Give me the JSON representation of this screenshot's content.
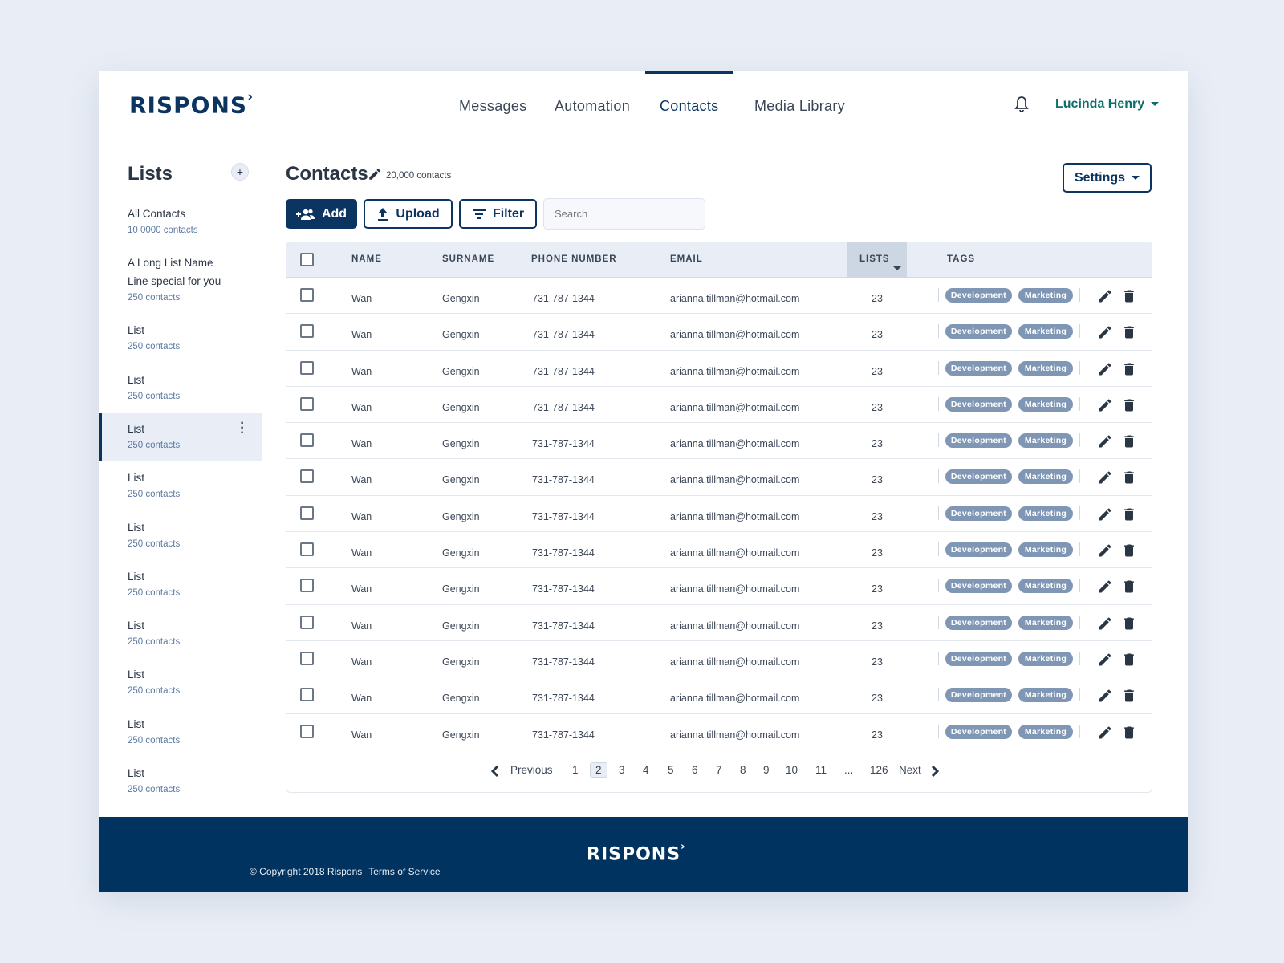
{
  "brand": "RISPONS",
  "nav": {
    "items": [
      {
        "label": "Messages"
      },
      {
        "label": "Automation"
      },
      {
        "label": "Contacts",
        "active": true
      },
      {
        "label": "Media Library"
      }
    ]
  },
  "user": {
    "name": "Lucinda Henry"
  },
  "sidebar": {
    "title": "Lists",
    "items": [
      {
        "name": "All Contacts",
        "count": "10 0000 contacts"
      },
      {
        "name": "A Long List Name Line special for you",
        "count": "250 contacts"
      },
      {
        "name": "List",
        "count": "250 contacts"
      },
      {
        "name": "List",
        "count": "250 contacts"
      },
      {
        "name": "List",
        "count": "250 contacts",
        "active": true
      },
      {
        "name": "List",
        "count": "250 contacts"
      },
      {
        "name": "List",
        "count": "250 contacts"
      },
      {
        "name": "List",
        "count": "250 contacts"
      },
      {
        "name": "List",
        "count": "250 contacts"
      },
      {
        "name": "List",
        "count": "250 contacts"
      },
      {
        "name": "List",
        "count": "250 contacts"
      },
      {
        "name": "List",
        "count": "250 contacts"
      }
    ]
  },
  "main": {
    "title": "Contacts",
    "count": "20,000 contacts",
    "add_label": "Add",
    "upload_label": "Upload",
    "filter_label": "Filter",
    "search_placeholder": "Search",
    "settings_label": "Settings"
  },
  "table": {
    "columns": [
      "NAME",
      "SURNAME",
      "PHONE NUMBER",
      "EMAIL",
      "LISTS",
      "TAGS"
    ],
    "rows": [
      {
        "name": "Wan",
        "surname": "Gengxin",
        "phone": "731-787-1344",
        "email": "arianna.tillman@hotmail.com",
        "lists": "23",
        "tags": [
          "Development",
          "Marketing"
        ]
      },
      {
        "name": "Wan",
        "surname": "Gengxin",
        "phone": "731-787-1344",
        "email": "arianna.tillman@hotmail.com",
        "lists": "23",
        "tags": [
          "Development",
          "Marketing"
        ]
      },
      {
        "name": "Wan",
        "surname": "Gengxin",
        "phone": "731-787-1344",
        "email": "arianna.tillman@hotmail.com",
        "lists": "23",
        "tags": [
          "Development",
          "Marketing"
        ]
      },
      {
        "name": "Wan",
        "surname": "Gengxin",
        "phone": "731-787-1344",
        "email": "arianna.tillman@hotmail.com",
        "lists": "23",
        "tags": [
          "Development",
          "Marketing"
        ]
      },
      {
        "name": "Wan",
        "surname": "Gengxin",
        "phone": "731-787-1344",
        "email": "arianna.tillman@hotmail.com",
        "lists": "23",
        "tags": [
          "Development",
          "Marketing"
        ]
      },
      {
        "name": "Wan",
        "surname": "Gengxin",
        "phone": "731-787-1344",
        "email": "arianna.tillman@hotmail.com",
        "lists": "23",
        "tags": [
          "Development",
          "Marketing"
        ]
      },
      {
        "name": "Wan",
        "surname": "Gengxin",
        "phone": "731-787-1344",
        "email": "arianna.tillman@hotmail.com",
        "lists": "23",
        "tags": [
          "Development",
          "Marketing"
        ]
      },
      {
        "name": "Wan",
        "surname": "Gengxin",
        "phone": "731-787-1344",
        "email": "arianna.tillman@hotmail.com",
        "lists": "23",
        "tags": [
          "Development",
          "Marketing"
        ]
      },
      {
        "name": "Wan",
        "surname": "Gengxin",
        "phone": "731-787-1344",
        "email": "arianna.tillman@hotmail.com",
        "lists": "23",
        "tags": [
          "Development",
          "Marketing"
        ]
      },
      {
        "name": "Wan",
        "surname": "Gengxin",
        "phone": "731-787-1344",
        "email": "arianna.tillman@hotmail.com",
        "lists": "23",
        "tags": [
          "Development",
          "Marketing"
        ]
      },
      {
        "name": "Wan",
        "surname": "Gengxin",
        "phone": "731-787-1344",
        "email": "arianna.tillman@hotmail.com",
        "lists": "23",
        "tags": [
          "Development",
          "Marketing"
        ]
      },
      {
        "name": "Wan",
        "surname": "Gengxin",
        "phone": "731-787-1344",
        "email": "arianna.tillman@hotmail.com",
        "lists": "23",
        "tags": [
          "Development",
          "Marketing"
        ]
      },
      {
        "name": "Wan",
        "surname": "Gengxin",
        "phone": "731-787-1344",
        "email": "arianna.tillman@hotmail.com",
        "lists": "23",
        "tags": [
          "Development",
          "Marketing"
        ]
      }
    ]
  },
  "pagination": {
    "previous": "Previous",
    "next": "Next",
    "pages": [
      "1",
      "2",
      "3",
      "4",
      "5",
      "6",
      "7",
      "8",
      "9",
      "10",
      "11",
      "...",
      "126"
    ],
    "current": "2"
  },
  "footer": {
    "copyright": "© Copyright 2018 Rispons",
    "terms": "Terms of Service"
  }
}
